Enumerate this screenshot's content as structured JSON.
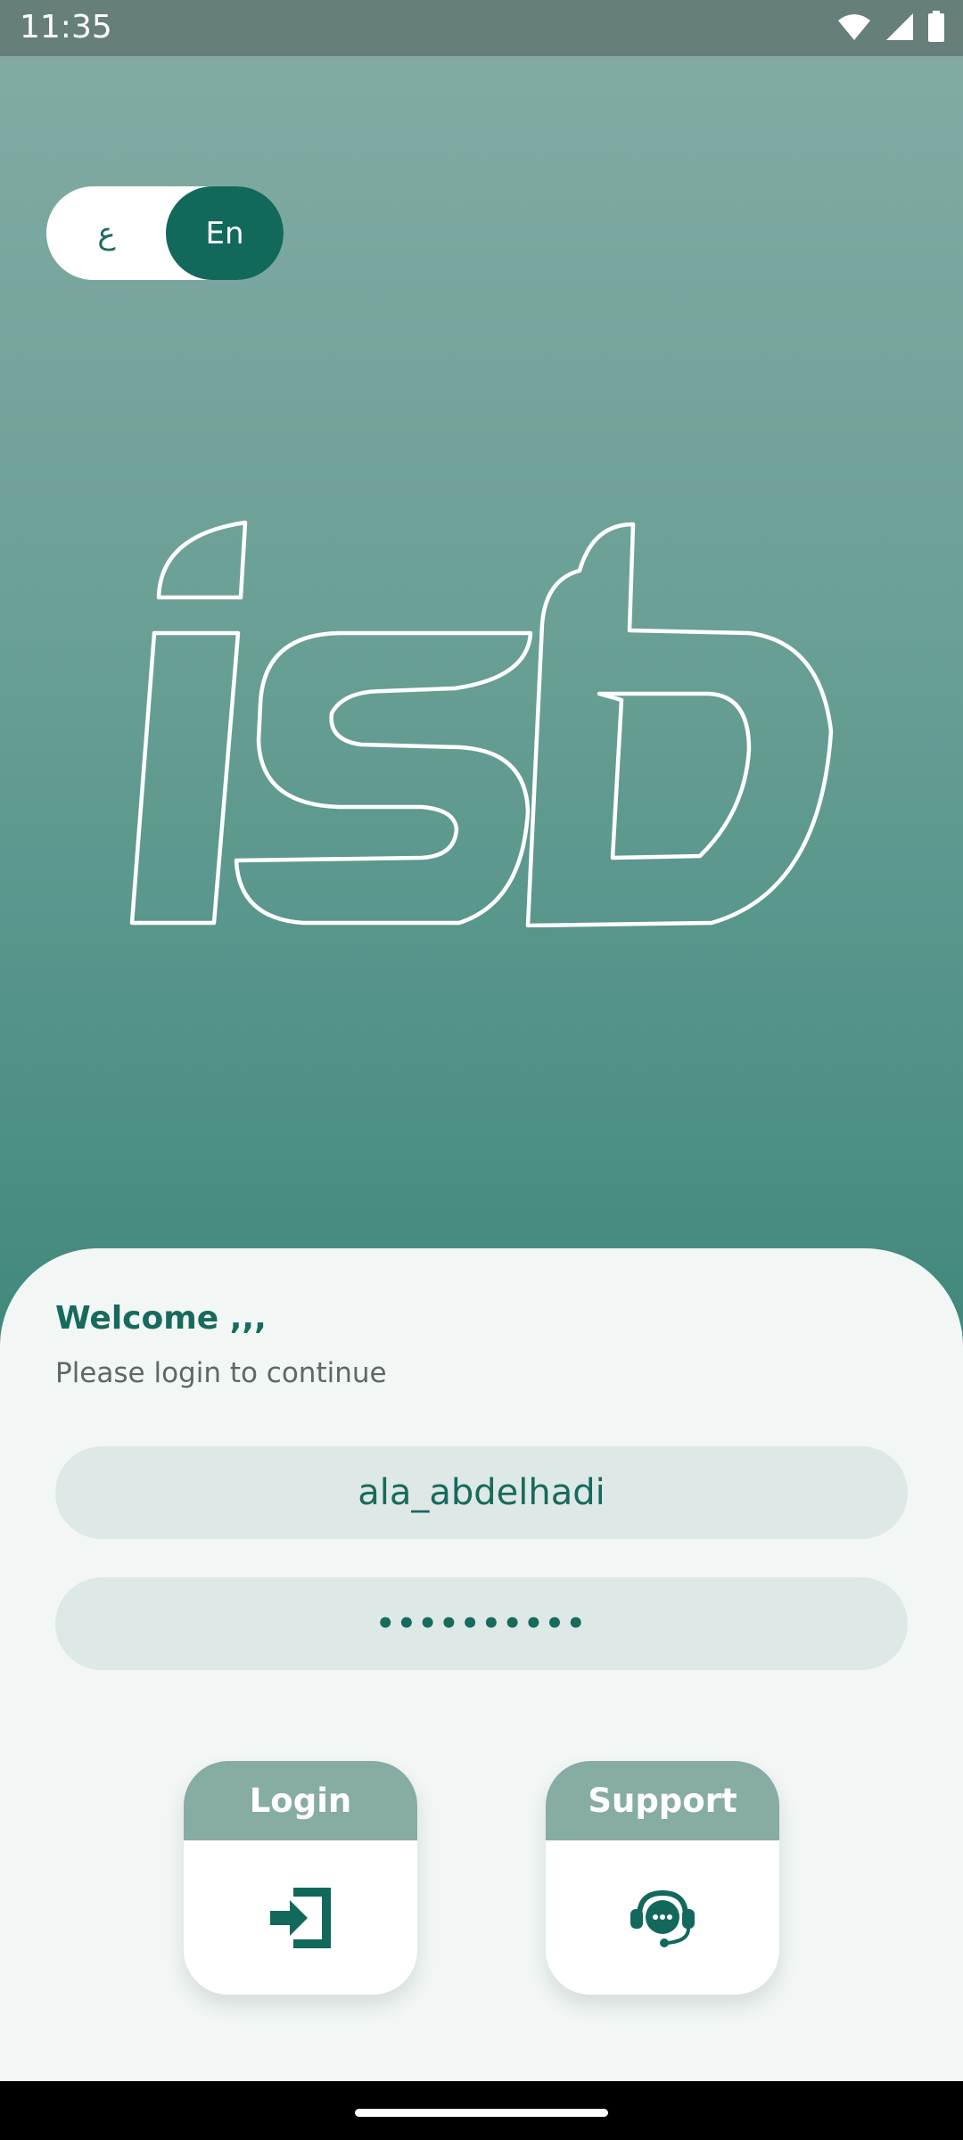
{
  "status_bar": {
    "time": "11:35",
    "icons": [
      "wifi-icon",
      "signal-icon",
      "battery-icon"
    ]
  },
  "language_toggle": {
    "arabic_label": "ع",
    "english_label": "En",
    "selected": "En"
  },
  "logo": {
    "text": "isb"
  },
  "login_card": {
    "welcome": "Welcome ,,,",
    "subtitle": "Please login to continue",
    "username_value": "ala_abdelhadi",
    "password_masked": "••••••••••"
  },
  "actions": {
    "login_label": "Login",
    "login_icon": "login-icon",
    "support_label": "Support",
    "support_icon": "support-headset-icon"
  },
  "colors": {
    "primary": "#12695b",
    "accent": "#86aca4",
    "sheet": "#f2f6f5",
    "field": "#dee8e6"
  }
}
